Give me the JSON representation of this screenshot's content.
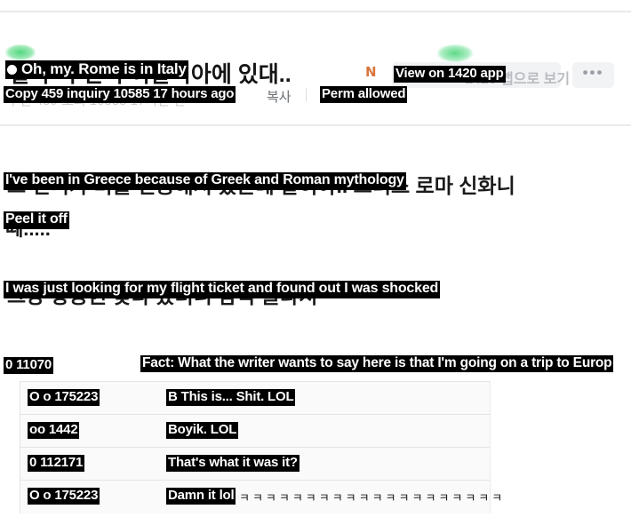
{
  "header": {
    "title_overlay": "Oh, my. Rome is in Italy",
    "title_source": "헐 우리 언니 이탈리아에 있대..",
    "naver_icon": "naver-n-icon",
    "view_button_overlay": "View on 1420 app",
    "view_button_source": "1420 앱으로 보기",
    "more_button": "•••"
  },
  "meta": {
    "overlay": "Copy 459 inquiry 10585 17 hours ago",
    "source": "추천 459 조회 10585 17시간 전",
    "copy_label": "복사",
    "perm_overlay": "Perm allowed"
  },
  "body": {
    "line1_overlay": "I've been in Greece because of Greek and Roman mythology",
    "line1_source": "그 언니가 미술 전공해서 갔는데 말이야.. 그리스 로마 신화니",
    "line1_tail": "리스 로마 신화니",
    "line2_overlay": "Peel it off",
    "line2_source": "떼.....",
    "line3_overlay": "I was just looking for my flight ticket and found out I was shocked",
    "line3_source": "그냥 항공권 찾다 봤더니 깜짝 놀라서"
  },
  "stats": {
    "counts_overlay": "0 11070",
    "fact_overlay": "Fact: What the writer wants to say here is that I'm going on a trip to Europ"
  },
  "comments": {
    "rows": [
      {
        "user": "O o 175223",
        "text": "B This is... Shit. LOL",
        "tail": ""
      },
      {
        "user": "oo 1442",
        "text": "Boyik. LOL",
        "tail": ""
      },
      {
        "user": "0 112171",
        "text": "That's what it was it?",
        "tail": ""
      },
      {
        "user": "O o 175223",
        "text": "Damn it lol",
        "tail": "ㅋㅋㅋㅋㅋㅋㅋㅋㅋㅋㅋㅋㅋㅋㅋㅋㅋㅋㅋㅋ"
      }
    ]
  },
  "colors": {
    "overlay_bg": "#000000",
    "overlay_fg": "#ffffff",
    "naver_orange": "#d9743c",
    "accent_green": "#35d06a",
    "divider": "#e9eaec",
    "table_bg": "#fafafa"
  }
}
